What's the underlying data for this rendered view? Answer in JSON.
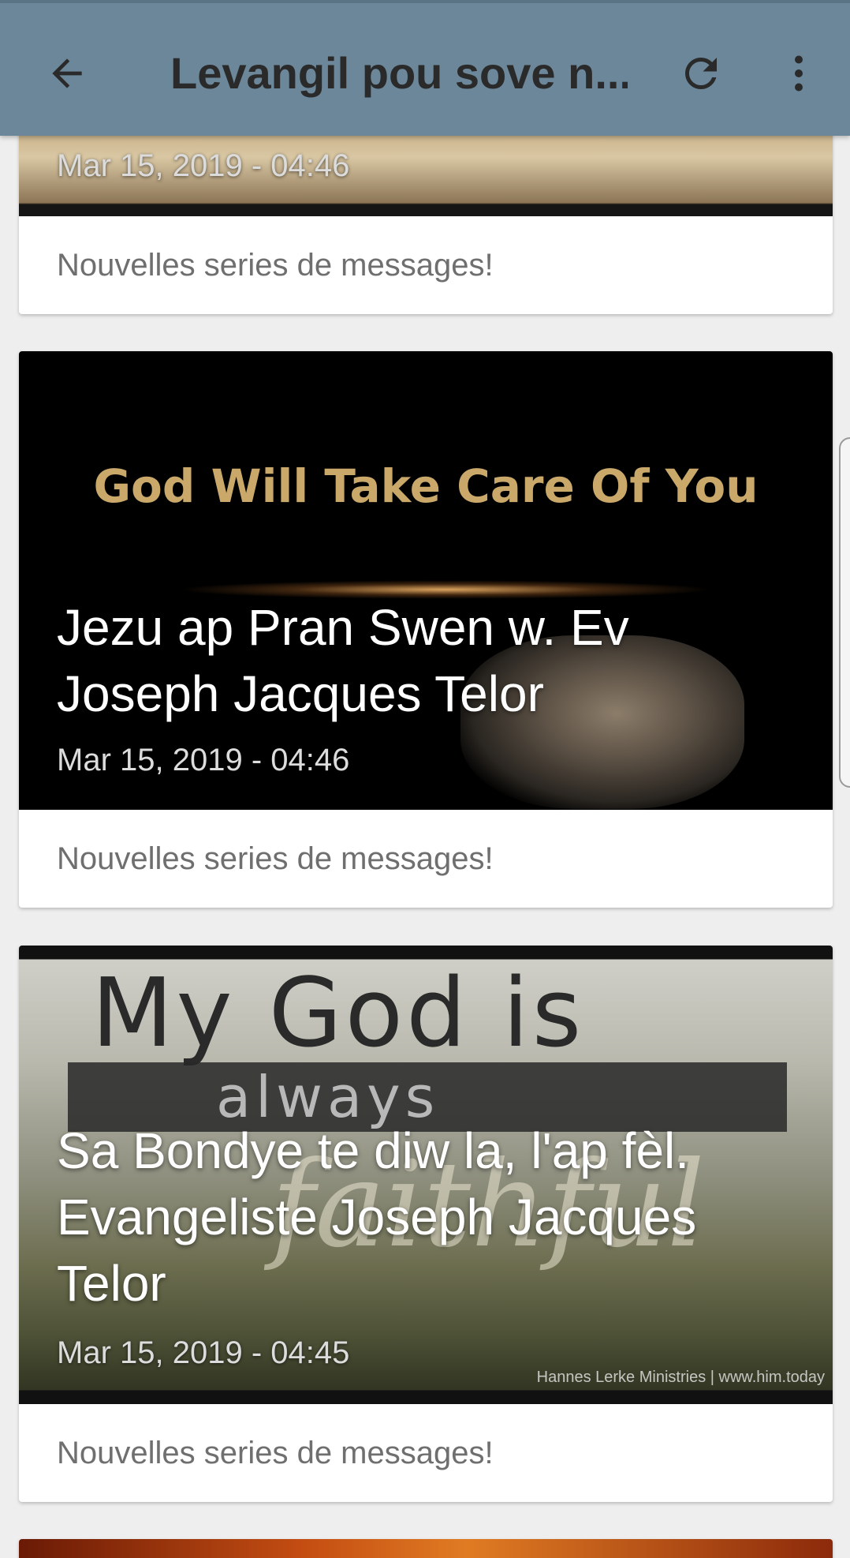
{
  "appbar": {
    "title": "Levangil pou sove n...",
    "back_icon": "arrow-left-icon",
    "refresh_icon": "refresh-icon",
    "more_icon": "more-vert-icon",
    "background": "#6b8799"
  },
  "posts": [
    {
      "caption": "",
      "date": "Mar 15, 2019 - 04:46",
      "description": "Nouvelles series de messages!"
    },
    {
      "image_text": "God Will Take Care Of You",
      "caption": "Jezu ap Pran Swen w.  Ev Joseph Jacques Telor",
      "date": "Mar 15, 2019 - 04:46",
      "description": "Nouvelles series de messages!"
    },
    {
      "image_text_1": "My God is",
      "image_text_2": "always",
      "image_text_3": "faithful",
      "image_credit": "Hannes Lerke Ministries | www.him.today",
      "caption": "Sa Bondye te diw la, l'ap fèl. Evangeliste Joseph Jacques Telor",
      "date": "Mar 15, 2019 - 04:45",
      "description": "Nouvelles series de messages!"
    }
  ]
}
